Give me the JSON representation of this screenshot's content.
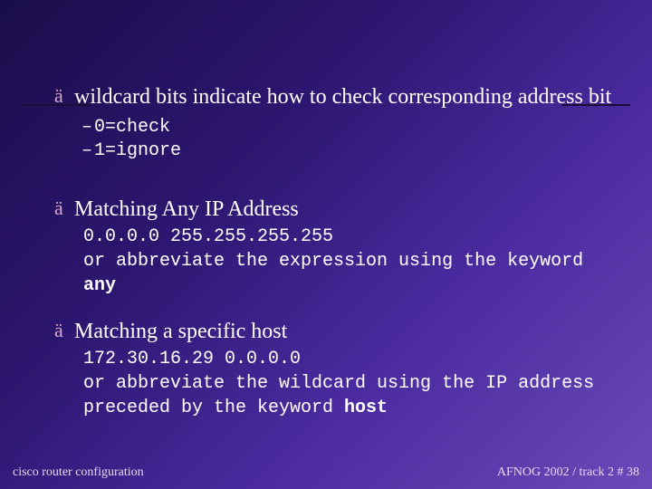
{
  "bullets": {
    "b1": {
      "main": "wildcard bits indicate how to check corresponding address bit",
      "sub1": "0=check",
      "sub2": "1=ignore"
    },
    "b2": {
      "main": "Matching Any IP Address",
      "code1": "0.0.0.0 255.255.255.255",
      "code2a": "or abbreviate the expression using the keyword ",
      "code2b": "any"
    },
    "b3": {
      "main": "Matching a specific host",
      "code1": "172.30.16.29 0.0.0.0",
      "code2a": "or abbreviate the wildcard using the IP address preceded by the keyword ",
      "code2b": "host"
    }
  },
  "footer": {
    "left": "cisco router configuration",
    "right": "AFNOG 2002 / track 2  # 38"
  }
}
